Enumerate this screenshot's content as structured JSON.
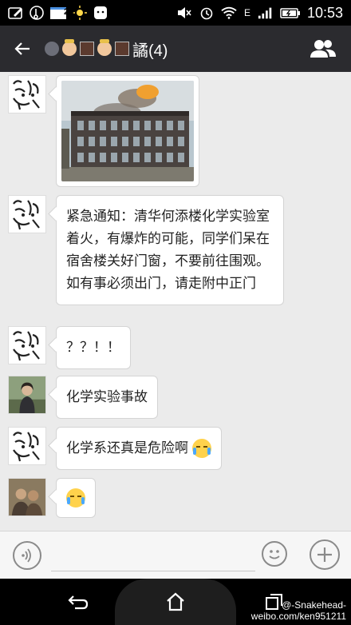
{
  "status_bar": {
    "time": "10:53",
    "calendar_day": "24",
    "network_label": "E"
  },
  "header": {
    "title_suffix": "譎(4)",
    "back_icon": "back-arrow-icon",
    "group_icon": "group-members-icon"
  },
  "messages": [
    {
      "sender": "doodle-avatar",
      "type": "image",
      "image_desc": "building-fire-photo"
    },
    {
      "sender": "doodle-avatar",
      "type": "text",
      "text": "紧急通知：清华何添楼化学实验室着火，有爆炸的可能，同学们呆在宿舍楼关好门窗，不要前往围观。如有事必须出门，请走附中正门"
    },
    {
      "sender": "doodle-avatar",
      "type": "text",
      "text": "？？！！"
    },
    {
      "sender": "photo-avatar-outdoor",
      "type": "text",
      "text": "化学实验事故"
    },
    {
      "sender": "doodle-avatar",
      "type": "text",
      "text": "化学系还真是危险啊",
      "emoji": "crying-laughing-emoji"
    },
    {
      "sender": "photo-avatar-group",
      "type": "emoji",
      "emoji": "crying-laughing-emoji"
    }
  ],
  "input_bar": {
    "voice_icon": "voice-input-icon",
    "emoji_icon": "emoji-picker-icon",
    "plus_icon": "plus-icon"
  },
  "watermark": {
    "line1": "@-Snakehead-",
    "line2": "weibo.com/ken951211"
  },
  "colors": {
    "header_bg": "#2b2b2f",
    "chat_bg": "#ebebeb",
    "bubble_bg": "#ffffff",
    "status_bg": "#000000"
  }
}
